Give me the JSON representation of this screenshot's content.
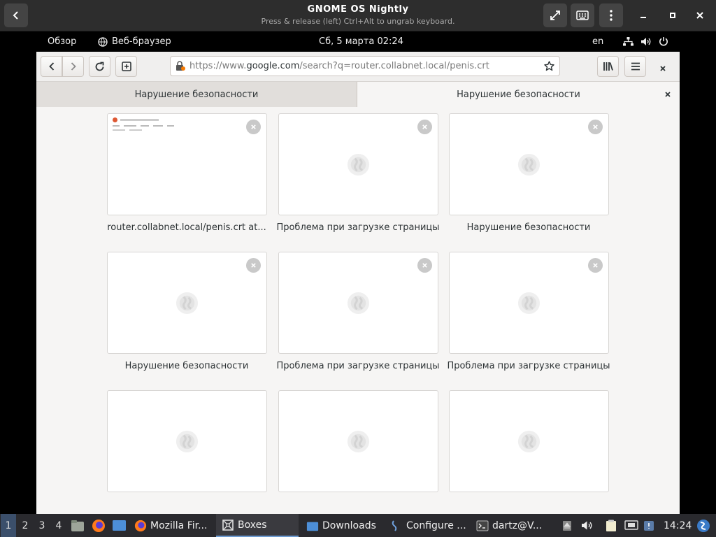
{
  "boxes": {
    "title": "GNOME OS Nightly",
    "subtitle": "Press & release (left) Ctrl+Alt to ungrab keyboard."
  },
  "gnome_topbar": {
    "activities": "Обзор",
    "app_name": "Веб-браузер",
    "clock": "Сб, 5 марта  02:24",
    "language": "en"
  },
  "browser": {
    "url_prefix": "https://www.",
    "url_domain": "google.com",
    "url_suffix": "/search?q=router.collabnet.local/penis.crt",
    "tabs": [
      {
        "label": "Нарушение безопасности"
      },
      {
        "label": "Нарушение безопасности"
      }
    ],
    "tiles": [
      {
        "label": "router.collabnet.local/penis.crt at..."
      },
      {
        "label": "Проблема при загрузке страницы"
      },
      {
        "label": "Нарушение безопасности"
      },
      {
        "label": "Нарушение безопасности"
      },
      {
        "label": "Проблема при загрузке страницы"
      },
      {
        "label": "Проблема при загрузке страницы"
      },
      {
        "label": ""
      },
      {
        "label": ""
      },
      {
        "label": ""
      }
    ]
  },
  "taskbar": {
    "workspaces": [
      "1",
      "2",
      "3",
      "4"
    ],
    "tasks": [
      {
        "label": "Mozilla Fir..."
      },
      {
        "label": "Boxes"
      },
      {
        "label": "Downloads"
      },
      {
        "label": "Configure ..."
      },
      {
        "label": "dartz@V..."
      }
    ],
    "time": "14:24"
  },
  "colors": {
    "boxes_header": "#2d2d2d",
    "browser_bg": "#f6f5f4",
    "taskbar_bg": "#2a2a2e"
  }
}
